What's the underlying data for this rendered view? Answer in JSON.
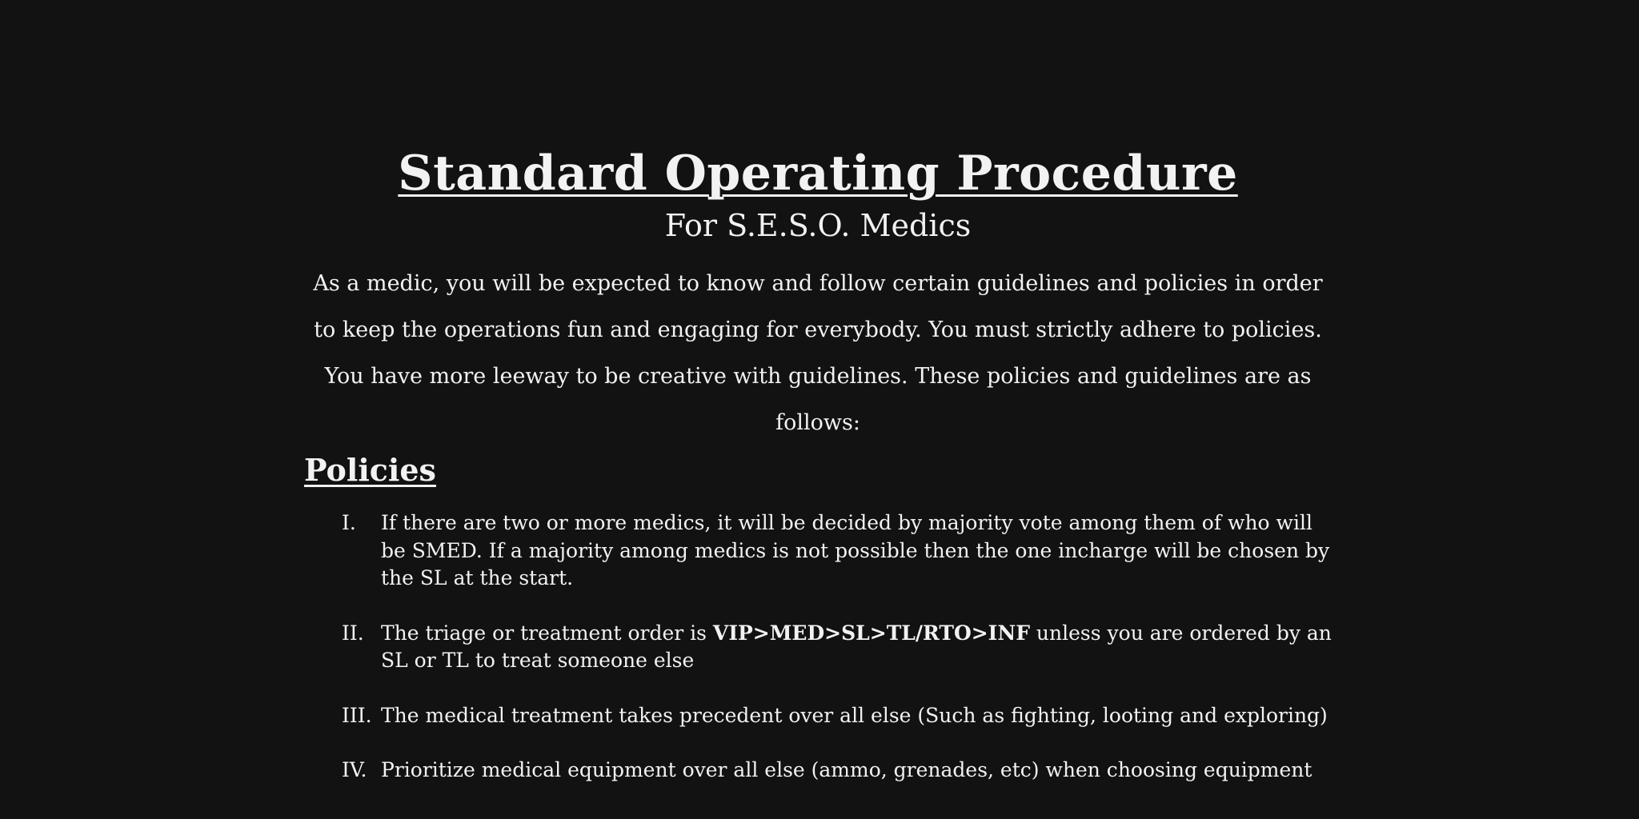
{
  "document": {
    "title": "Standard Operating Procedure",
    "subtitle": "For S.E.S.O. Medics",
    "intro": "As a medic, you will be expected to know and follow certain guidelines and policies in order to keep the operations fun and engaging for everybody. You must strictly adhere to policies. You have more leeway to be creative with guidelines. These policies and guidelines are as follows:",
    "policies": {
      "heading": "Policies",
      "items": [
        {
          "number": "I.",
          "text": "If there are two or more medics, it will be decided by majority vote among them of who will be SMED. If a majority among medics is not possible then the one incharge will be chosen by the SL at the start."
        },
        {
          "number": "II.",
          "text_before": "The triage or treatment order is ",
          "text_bold": "VIP>MED>SL>TL/RTO>INF",
          "text_after": " unless you are ordered by an SL or TL to treat someone else"
        },
        {
          "number": "III.",
          "text": "The medical treatment takes precedent over all else (Such as fighting, looting and exploring)"
        },
        {
          "number": "IV.",
          "text": "Prioritize medical equipment over all else (ammo, grenades, etc) when choosing equipment"
        }
      ]
    }
  }
}
